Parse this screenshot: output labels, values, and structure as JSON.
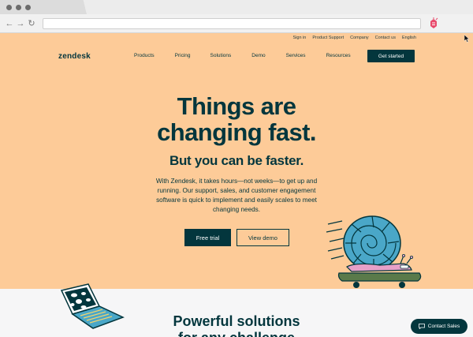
{
  "browser": {
    "nav": {
      "back": "←",
      "forward": "→",
      "reload": "↻"
    },
    "url": ""
  },
  "utility_nav": [
    "Sign in",
    "Product Support",
    "Company",
    "Contact us",
    "English"
  ],
  "header": {
    "logo": "zendesk",
    "nav": [
      "Products",
      "Pricing",
      "Solutions",
      "Demo",
      "Services",
      "Resources"
    ],
    "cta": "Get started"
  },
  "hero": {
    "headline_line1": "Things are",
    "headline_line2": "changing fast.",
    "subhead": "But you can be faster.",
    "body_line1": "With Zendesk, it takes hours—not weeks—to get up and",
    "body_line2": "running. Our support, sales, and customer engagement",
    "body_line3": "software is quick to implement and easily scales to meet",
    "body_line4": "changing needs.",
    "primary_button": "Free trial",
    "secondary_button": "View demo"
  },
  "section2": {
    "heading_line1": "Powerful solutions",
    "heading_line2": "for any challenge"
  },
  "contact_sales": "Contact Sales",
  "colors": {
    "hero_bg": "#fdcb98",
    "brand_dark": "#03363d",
    "section_bg": "#f6f6f7",
    "snail_shell": "#4aa7c8",
    "snail_body": "#e7a0c8",
    "skateboard": "#5a7a4a"
  },
  "icons": [
    "back-icon",
    "forward-icon",
    "reload-icon",
    "extension-icon",
    "cursor-icon",
    "chat-icon"
  ]
}
